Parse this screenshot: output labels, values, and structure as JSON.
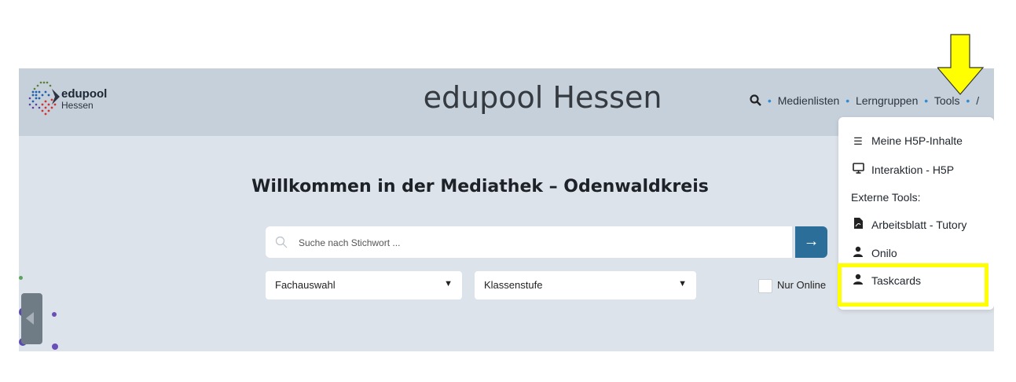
{
  "header": {
    "logo_main": "edupool",
    "logo_sub": "Hessen",
    "site_title": "edupool Hessen",
    "nav": {
      "search_icon": "search-icon",
      "items": [
        "Medienlisten",
        "Lerngruppen",
        "Tools"
      ],
      "trailing": "/"
    }
  },
  "main": {
    "welcome": "Willkommen in der Mediathek – Odenwaldkreis",
    "search": {
      "placeholder": "Suche nach Stichwort ...",
      "button_icon": "arrow-right-icon"
    },
    "filters": {
      "fach": "Fachauswahl",
      "klasse": "Klassenstufe",
      "online_label": "Nur Online"
    }
  },
  "tools_menu": {
    "items": [
      {
        "label": "Meine H5P-Inhalte",
        "icon": "list-icon"
      },
      {
        "label": "Interaktion - H5P",
        "icon": "monitor-icon"
      }
    ],
    "external_heading": "Externe Tools:",
    "external_items": [
      {
        "label": "Arbeitsblatt - Tutory",
        "icon": "pdf-file-icon"
      },
      {
        "label": "Onilo",
        "icon": "user-icon"
      },
      {
        "label": "Taskcards",
        "icon": "user-icon"
      }
    ]
  },
  "colors": {
    "header_bg": "#c5d0da",
    "page_bg": "#dde3ea",
    "accent": "#2c6e9a",
    "highlight": "#ffff00",
    "nav_dot": "#2e8bd6"
  }
}
